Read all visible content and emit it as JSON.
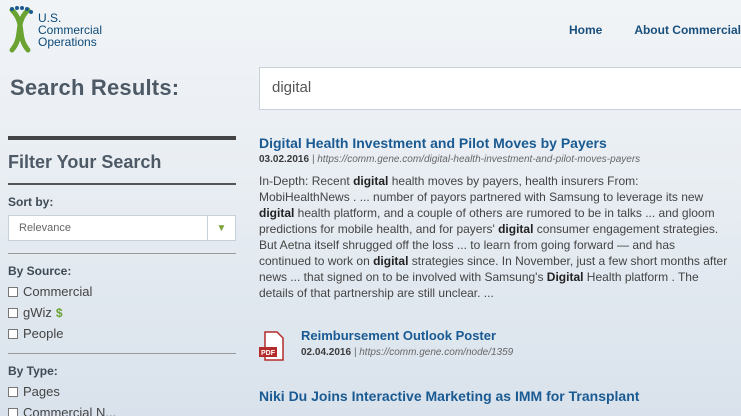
{
  "header": {
    "logo_lines": [
      "U.S.",
      "Commercial",
      "Operations"
    ],
    "nav": [
      "Home",
      "About Commercial"
    ]
  },
  "search": {
    "title": "Search Results:",
    "query": "digital"
  },
  "filter": {
    "title": "Filter Your Search",
    "sort_label": "Sort by:",
    "sort_value": "Relevance",
    "source_label": "By Source:",
    "sources": [
      "Commercial",
      "gWiz",
      "People"
    ],
    "gwiz_badge": "$",
    "type_label": "By Type:",
    "types": [
      "Pages",
      "Commercial N..."
    ]
  },
  "results": [
    {
      "title": "Digital Health Investment and Pilot Moves by Payers",
      "date": "03.02.2016",
      "separator": "|",
      "url": "https://comm.gene.com/digital-health-investment-and-pilot-moves-payers",
      "snippet_parts": [
        {
          "t": "In-Depth: Recent ",
          "b": false
        },
        {
          "t": "digital",
          "b": true
        },
        {
          "t": " health moves by payers, health insurers From: MobiHealthNews . ... number of payors partnered with Samsung to leverage its new ",
          "b": false
        },
        {
          "t": "digital",
          "b": true
        },
        {
          "t": " health platform, and a couple of others are rumored to be in talks ... and gloom predictions for mobile health, and for payers' ",
          "b": false
        },
        {
          "t": "digital",
          "b": true
        },
        {
          "t": " consumer engagement strategies. But Aetna itself shrugged off the loss ... to learn from going forward — and has continued to work on ",
          "b": false
        },
        {
          "t": "digital",
          "b": true
        },
        {
          "t": " strategies since. In November, just a few short months after news ... that signed on to be involved with Samsung's ",
          "b": false
        },
        {
          "t": "Digital",
          "b": true
        },
        {
          "t": " Health platform . The details of that partnership are still unclear. ...",
          "b": false
        }
      ]
    },
    {
      "title": "Reimbursement Outlook Poster",
      "date": "02.04.2016",
      "separator": "|",
      "url": "https://comm.gene.com/node/1359",
      "icon_label": "PDF"
    },
    {
      "title": "Niki Du Joins Interactive Marketing as IMM for Transplant"
    }
  ],
  "colors": {
    "accent": "#1a5a92",
    "brand_green": "#6aa332",
    "pdf_red": "#b42b2b"
  }
}
